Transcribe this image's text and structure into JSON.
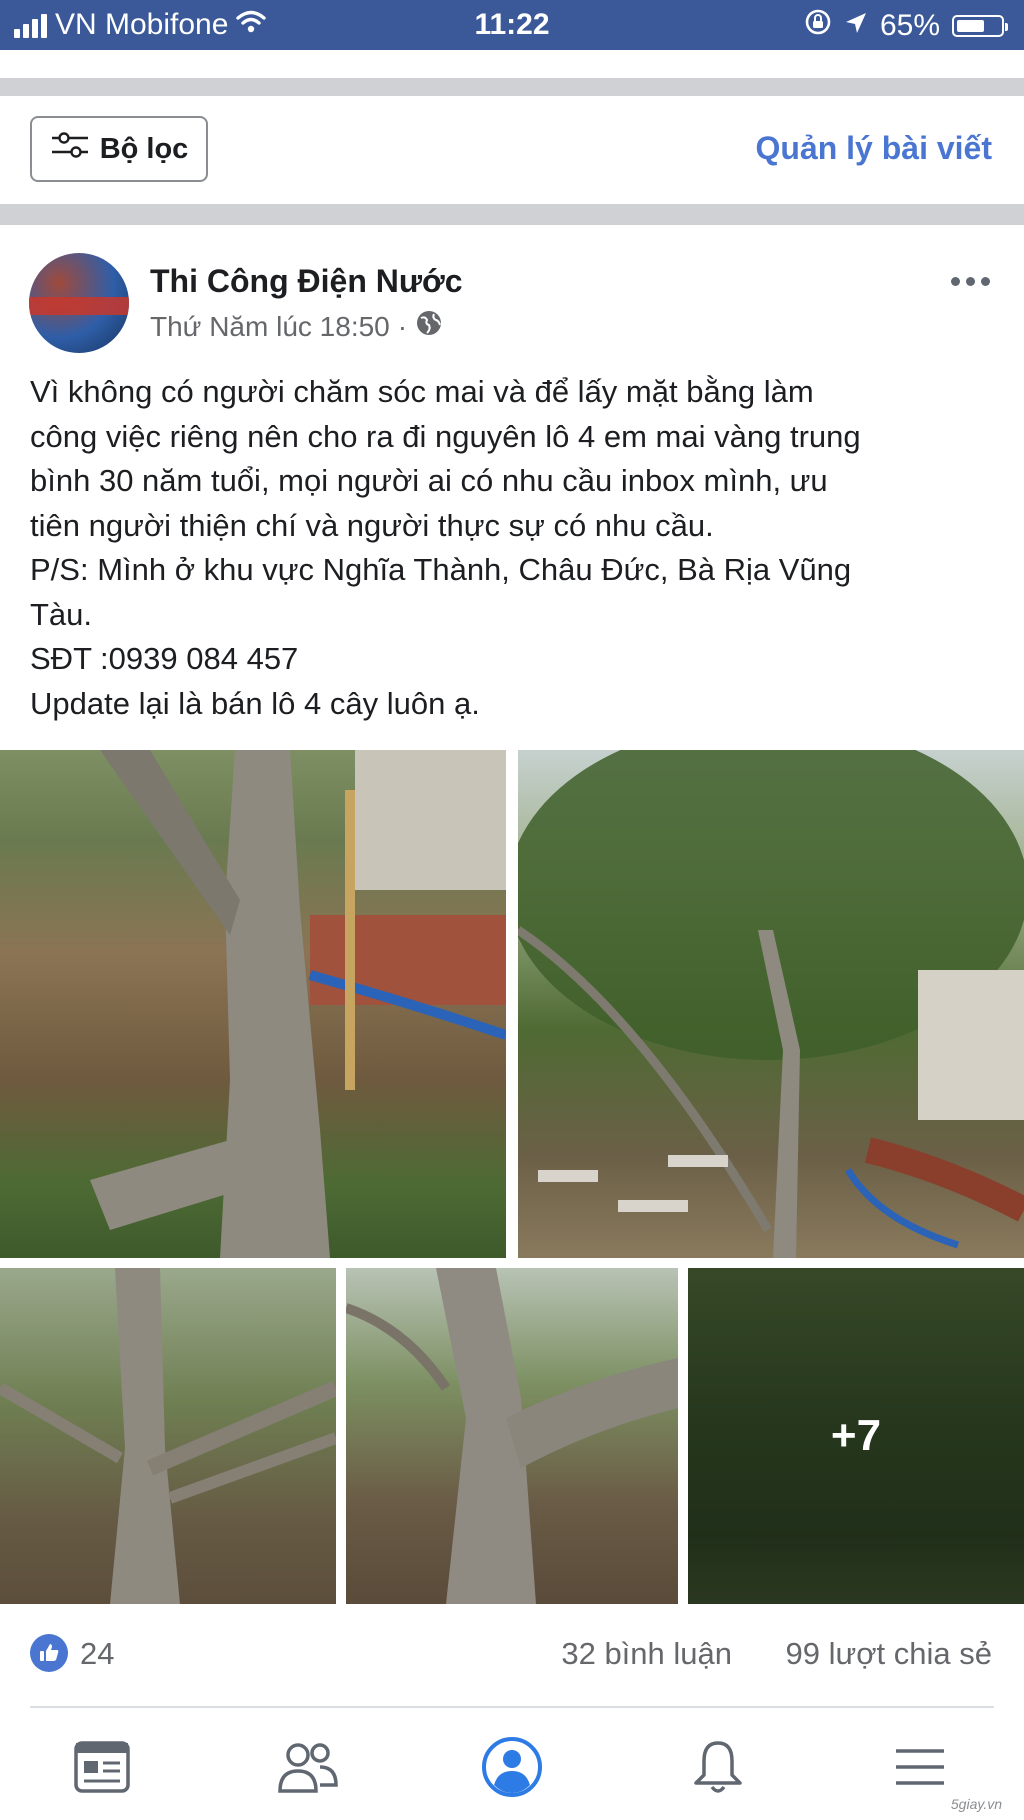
{
  "status_bar": {
    "carrier": "VN Mobifone",
    "time": "11:22",
    "battery": "65%",
    "battery_level": 0.65,
    "icons": [
      "signal-icon",
      "wifi-icon",
      "rotation-lock-icon",
      "location-arrow-icon",
      "battery-icon"
    ]
  },
  "filter_bar": {
    "filter_label": "Bộ lọc",
    "filter_icon": "sliders-icon",
    "manage_label": "Quản lý bài viết"
  },
  "post": {
    "author": "Thi Công Điện Nước",
    "timestamp": "Thứ Năm lúc 18:50",
    "separator": "·",
    "privacy_icon": "globe-icon",
    "more_icon": "more-dots-icon",
    "text_lines": [
      "Vì không có người chăm sóc mai và để lấy mặt bằng làm",
      "công việc riêng nên cho ra đi nguyên lô 4 em mai vàng trung",
      "bình 30 năm tuổi, mọi người ai có nhu cầu inbox mình, ưu",
      "tiên người thiện chí và người thực sự có nhu cầu.",
      "P/S: Mình ở khu vực Nghĩa Thành, Châu Đức, Bà Rịa Vũng",
      "Tàu.",
      "SĐT :0939 084 457",
      "Update lại là bán lô 4 cây luôn ạ."
    ],
    "photos_more": "+7",
    "likes": "24",
    "comments": "32 bình luận",
    "shares": "99 lượt chia sẻ"
  },
  "tab_bar": {
    "tabs": [
      {
        "name": "news-feed-icon"
      },
      {
        "name": "friends-icon"
      },
      {
        "name": "profile-icon",
        "active": true
      },
      {
        "name": "notifications-bell-icon"
      },
      {
        "name": "menu-icon"
      }
    ]
  },
  "watermark": "5giay.vn",
  "colors": {
    "status_bar_bg": "#3b5998",
    "link_blue": "#4a76d2",
    "secondary_text": "#65676b",
    "separator_gray": "#cfd1d5"
  }
}
